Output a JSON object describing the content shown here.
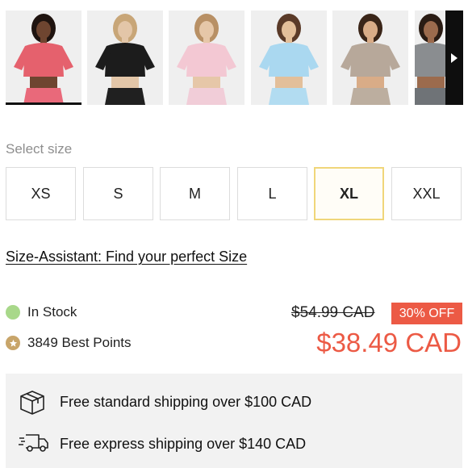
{
  "gallery": {
    "thumbnails": [
      {
        "label": "Coral",
        "top": "#e5616d",
        "bottom": "#e9697a",
        "skin": "#6e4530",
        "hair": "#1f1410"
      },
      {
        "label": "Black",
        "top": "#1c1c1c",
        "bottom": "#202020",
        "skin": "#e3c6a8",
        "hair": "#c8a678"
      },
      {
        "label": "Pink",
        "top": "#f3c8d3",
        "bottom": "#f1cdd8",
        "skin": "#e6c7a8",
        "hair": "#b89065"
      },
      {
        "label": "Sky Blue",
        "top": "#aad8f0",
        "bottom": "#b2dcf1",
        "skin": "#e3bf9a",
        "hair": "#5a3a28"
      },
      {
        "label": "Taupe",
        "top": "#b7a89a",
        "bottom": "#bcae9f",
        "skin": "#d9ac87",
        "hair": "#3a2518"
      },
      {
        "label": "Grey",
        "top": "#8a8d90",
        "bottom": "#6f7377",
        "skin": "#9c6b4d",
        "hair": "#2a1c14"
      }
    ],
    "next_icon": "chevron-right-icon"
  },
  "size": {
    "label": "Select size",
    "options": [
      "XS",
      "S",
      "M",
      "L",
      "XL",
      "XXL"
    ],
    "selected": "XL",
    "assistant_link": "Size-Assistant: Find your perfect Size"
  },
  "stock": {
    "text": "In Stock",
    "color": "#a8d88a"
  },
  "points": {
    "text": "3849 Best Points",
    "icon": "star-icon"
  },
  "price": {
    "original": "$54.99 CAD",
    "discount": "30% OFF",
    "current": "$38.49 CAD",
    "accent_color": "#ec5a45"
  },
  "shipping": {
    "standard": "Free standard shipping over $100 CAD",
    "express": "Free express shipping over $140 CAD"
  }
}
